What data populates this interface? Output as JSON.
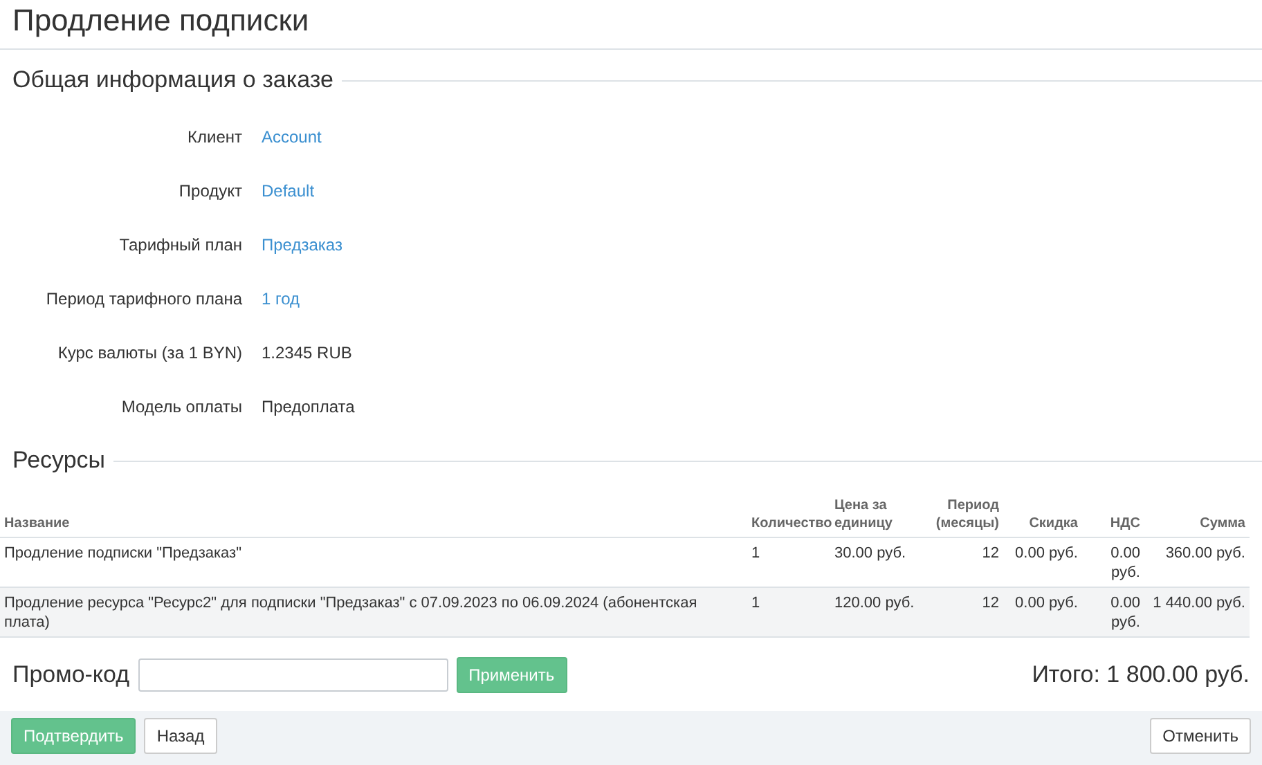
{
  "page_title": "Продление подписки",
  "order_info": {
    "heading": "Общая информация о заказе",
    "fields": [
      {
        "label": "Клиент",
        "value": "Account",
        "kind": "link"
      },
      {
        "label": "Продукт",
        "value": "Default",
        "kind": "link"
      },
      {
        "label": "Тарифный план",
        "value": "Предзаказ",
        "kind": "link"
      },
      {
        "label": "Период тарифного плана",
        "value": "1 год",
        "kind": "link"
      },
      {
        "label": "Курс валюты (за 1 BYN)",
        "value": "1.2345 RUB",
        "kind": "plain"
      },
      {
        "label": "Модель оплаты",
        "value": "Предоплата",
        "kind": "plain"
      }
    ]
  },
  "resources": {
    "heading": "Ресурсы",
    "table": {
      "columns": [
        {
          "label": "Название"
        },
        {
          "label": "Количество"
        },
        {
          "label": "Цена за единицу"
        },
        {
          "label": "Период (месяцы)"
        },
        {
          "label": "Скидка"
        },
        {
          "label": "НДС"
        },
        {
          "label": "Сумма"
        }
      ],
      "rows": [
        {
          "highlighted": false,
          "cells": [
            "Продление подписки \"Предзаказ\"",
            "1",
            "30.00 руб.",
            "12",
            "0.00 руб.",
            "0.00 руб.",
            "360.00 руб."
          ]
        },
        {
          "highlighted": true,
          "cells": [
            "Продление ресурса \"Ресурс2\" для подписки \"Предзаказ\" с 07.09.2023 по 06.09.2024 (абонентская плата)",
            "1",
            "120.00 руб.",
            "12",
            "0.00 руб.",
            "0.00 руб.",
            "1 440.00 руб."
          ]
        }
      ]
    }
  },
  "promo": {
    "label": "Промо-код",
    "apply_button": "Применить"
  },
  "total": "Итого: 1 800.00 руб.",
  "footer": {
    "confirm_button": "Подтвердить",
    "back_button": "Назад",
    "cancel_button": "Отменить"
  }
}
